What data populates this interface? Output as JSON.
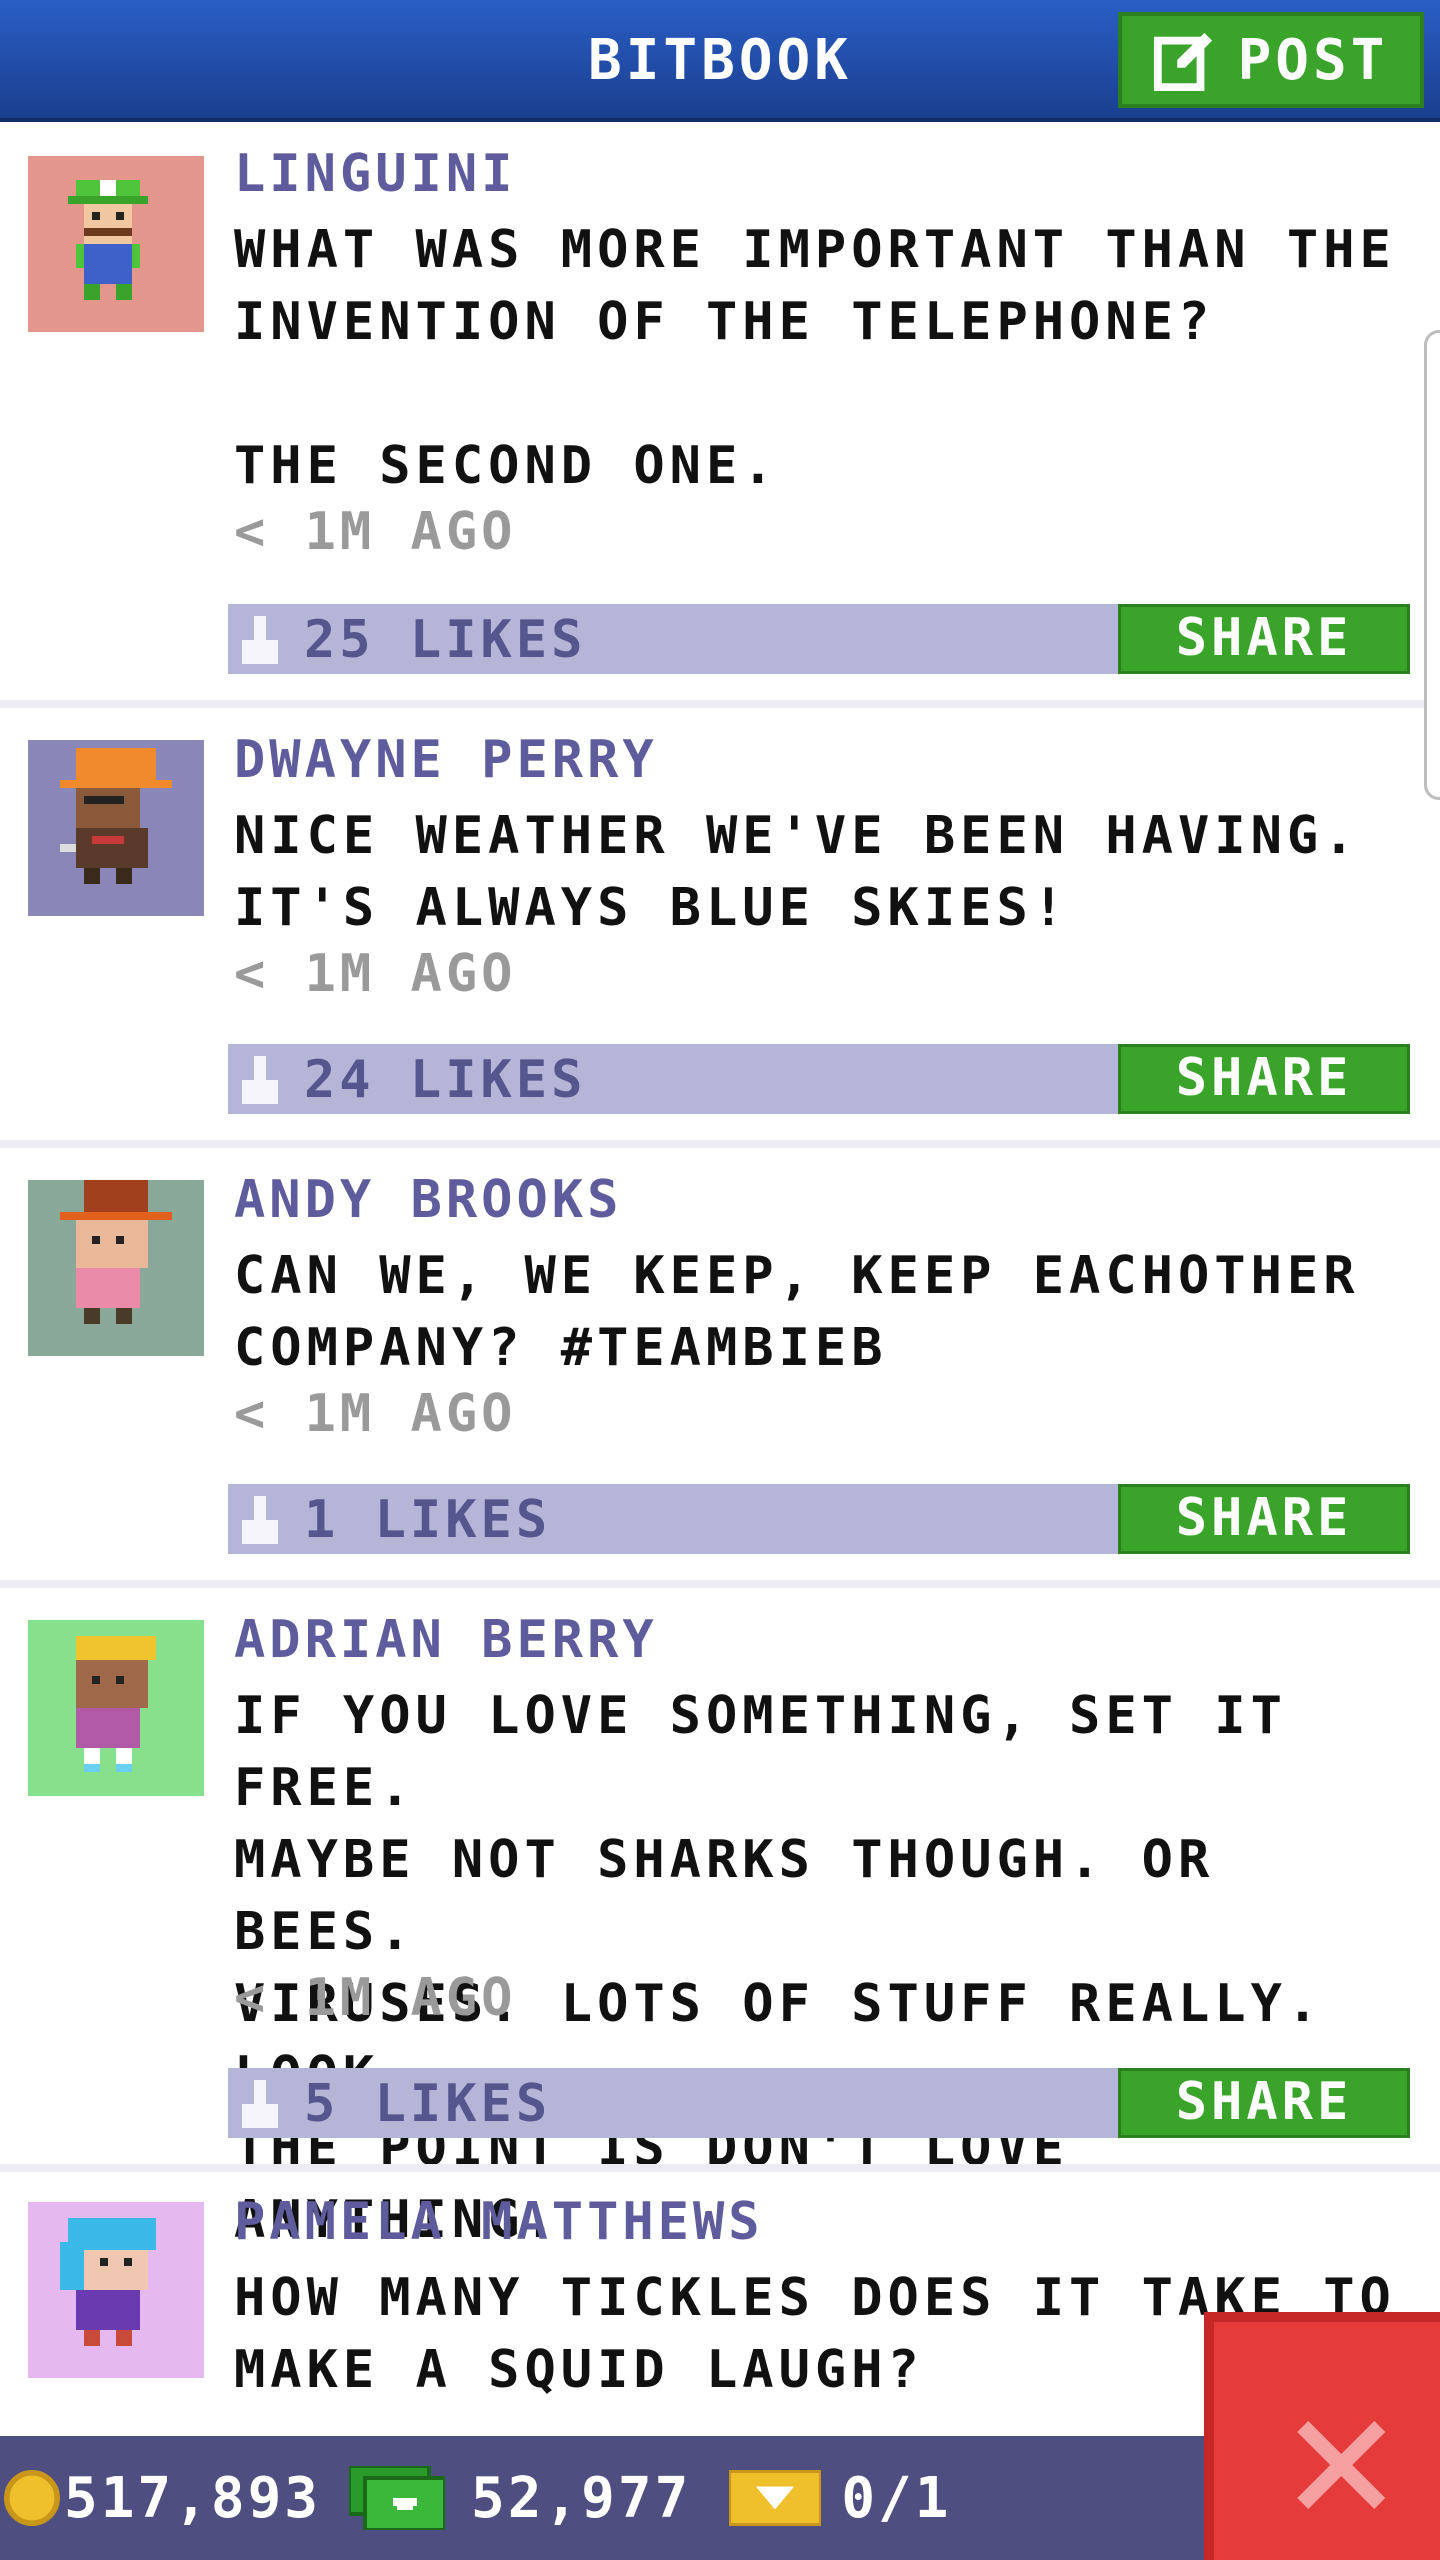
{
  "header": {
    "title": "BITBOOK",
    "post_label": "POST"
  },
  "posts": [
    {
      "author": "LINGUINI",
      "text": "WHAT WAS MORE IMPORTANT THAN THE\nINVENTION OF THE TELEPHONE?\n\nTHE SECOND ONE.",
      "time": "< 1M AGO",
      "likes": "25 LIKES",
      "share": "SHARE"
    },
    {
      "author": "DWAYNE PERRY",
      "text": "NICE WEATHER WE'VE BEEN HAVING.\nIT'S ALWAYS BLUE SKIES!",
      "time": "< 1M AGO",
      "likes": "24 LIKES",
      "share": "SHARE"
    },
    {
      "author": "ANDY BROOKS",
      "text": "CAN WE, WE KEEP, KEEP EACHOTHER\nCOMPANY? #TEAMBIEB",
      "time": "< 1M AGO",
      "likes": "1 LIKES",
      "share": "SHARE"
    },
    {
      "author": "ADRIAN BERRY",
      "text": "IF YOU LOVE SOMETHING, SET IT FREE.\nMAYBE NOT SHARKS THOUGH. OR BEES.\nVIRUSES. LOTS OF STUFF REALLY. LOOK,\nTHE POINT IS DON'T LOVE ANYTHING.",
      "time": "< 1M AGO",
      "likes": "5 LIKES",
      "share": "SHARE"
    },
    {
      "author": "PAMELA MATTHEWS",
      "text": "HOW MANY TICKLES DOES IT TAKE TO\nMAKE A SQUID LAUGH?"
    }
  ],
  "bottom_bar": {
    "coins": "517,893",
    "bux": "52,977",
    "tickets": "0/1"
  },
  "colors": {
    "header_blue": "#2a5ec6",
    "accent_green": "#3aa32a",
    "like_bar": "#b5b5d8",
    "author_purple": "#5e5c9c",
    "close_red": "#e53b3b"
  },
  "icons": [
    "compose-icon",
    "thumbs-up-icon",
    "coin-icon",
    "bux-icon",
    "ticket-icon",
    "close-icon"
  ]
}
